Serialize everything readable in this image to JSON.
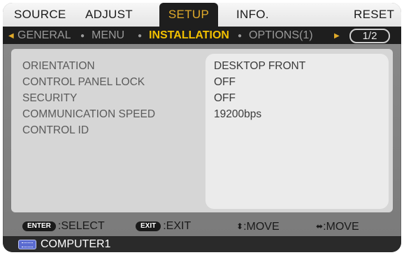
{
  "top_menu": {
    "tabs": [
      {
        "label": "SOURCE"
      },
      {
        "label": "ADJUST"
      },
      {
        "label": "SETUP",
        "active": true
      },
      {
        "label": "INFO."
      },
      {
        "label": "RESET"
      }
    ]
  },
  "sub_nav": {
    "items": [
      {
        "label": "GENERAL"
      },
      {
        "label": "MENU"
      },
      {
        "label": "INSTALLATION",
        "active": true
      },
      {
        "label": "OPTIONS(1)"
      }
    ],
    "page": "1/2"
  },
  "settings": [
    {
      "label": "ORIENTATION",
      "value": "DESKTOP FRONT"
    },
    {
      "label": "CONTROL PANEL LOCK",
      "value": "OFF"
    },
    {
      "label": "SECURITY",
      "value": "OFF"
    },
    {
      "label": "COMMUNICATION SPEED",
      "value": "19200bps"
    },
    {
      "label": "CONTROL ID",
      "value": ""
    }
  ],
  "hints": {
    "enter_key": "ENTER",
    "enter_action": ":SELECT",
    "exit_key": "EXIT",
    "exit_action": ":EXIT",
    "updown_action": ":MOVE",
    "leftright_action": ":MOVE"
  },
  "source": {
    "label": "COMPUTER1",
    "icon": "computer-icon"
  },
  "colors": {
    "accent": "#e0aa2a",
    "active_subnav": "#f2c000",
    "bar_dark": "#1e1e1e"
  }
}
